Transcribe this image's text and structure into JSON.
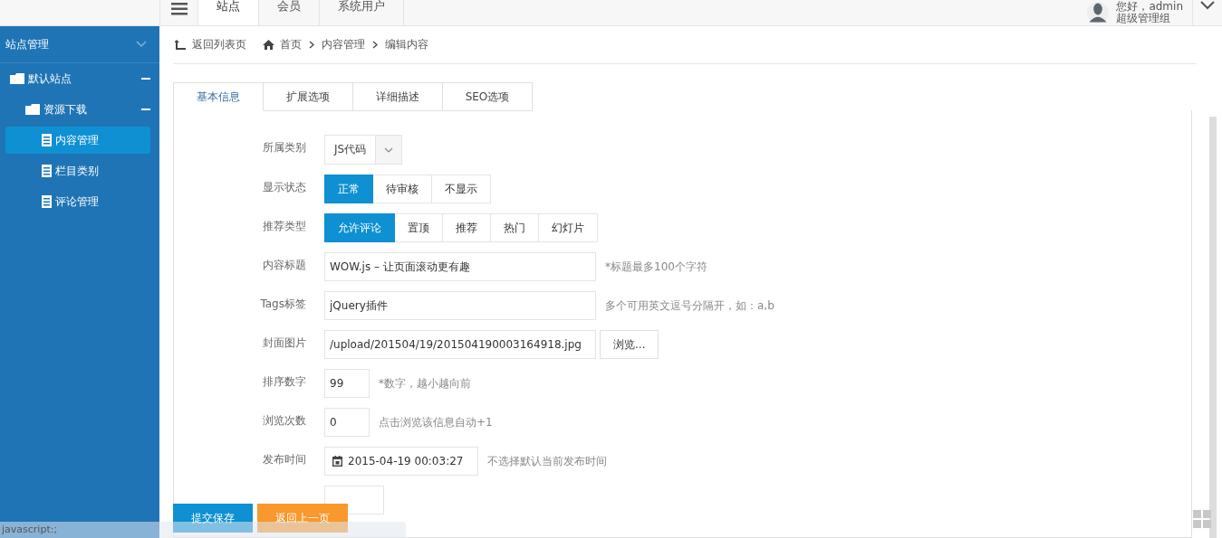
{
  "top_nav": {
    "tabs": [
      {
        "label": "站点",
        "selected": true
      },
      {
        "label": "会员",
        "selected": false
      },
      {
        "label": "系统用户",
        "selected": false
      }
    ],
    "user": {
      "greeting": "您好，admin",
      "role": "超级管理组"
    }
  },
  "sidebar": {
    "title": "站点管理",
    "items": [
      {
        "label": "默认站点",
        "expanded": true,
        "children": [
          {
            "label": "资源下载",
            "expanded": true,
            "children": [
              {
                "label": "内容管理",
                "selected": true
              },
              {
                "label": "栏目类别",
                "selected": false
              },
              {
                "label": "评论管理",
                "selected": false
              }
            ]
          }
        ]
      }
    ]
  },
  "breadcrumb": {
    "back": "返回列表页",
    "path": [
      "首页",
      "内容管理",
      "编辑内容"
    ]
  },
  "tabs": [
    {
      "label": "基本信息",
      "selected": true
    },
    {
      "label": "扩展选项",
      "selected": false
    },
    {
      "label": "详细描述",
      "selected": false
    },
    {
      "label": "SEO选项",
      "selected": false
    }
  ],
  "form": [
    {
      "kind": "select",
      "label": "所属类别",
      "value": "JS代码"
    },
    {
      "kind": "choice",
      "label": "显示状态",
      "options": [
        {
          "label": "正常",
          "selected": true
        },
        {
          "label": "待审核",
          "selected": false
        },
        {
          "label": "不显示",
          "selected": false
        }
      ]
    },
    {
      "kind": "choice",
      "label": "推荐类型",
      "options": [
        {
          "label": "允许评论",
          "selected": true
        },
        {
          "label": "置顶",
          "selected": false
        },
        {
          "label": "推荐",
          "selected": false
        },
        {
          "label": "热门",
          "selected": false
        },
        {
          "label": "幻灯片",
          "selected": false
        }
      ]
    },
    {
      "kind": "wide",
      "label": "内容标题",
      "value": "WOW.js – 让页面滚动更有趣",
      "hint": "*标题最多100个字符"
    },
    {
      "kind": "wide",
      "label": "Tags标签",
      "value": "jQuery插件",
      "hint": "多个可用英文逗号分隔开，如：a,b"
    },
    {
      "kind": "file",
      "label": "封面图片",
      "value": "/upload/201504/19/201504190003164918.jpg",
      "button": "浏览..."
    },
    {
      "kind": "short",
      "label": "排序数字",
      "value": "99",
      "hint": "*数字，越小越向前"
    },
    {
      "kind": "short",
      "label": "浏览次数",
      "value": "0",
      "hint": "点击浏览该信息自动+1"
    },
    {
      "kind": "date",
      "label": "发布时间",
      "value": "2015-04-19 00:03:27",
      "hint": "不选择默认当前发布时间"
    }
  ],
  "footer_buttons": [
    {
      "label": "提交保存",
      "kind": "primary"
    },
    {
      "label": "返回上一页",
      "kind": "secondary"
    }
  ],
  "status_bar": "javascript:;"
}
